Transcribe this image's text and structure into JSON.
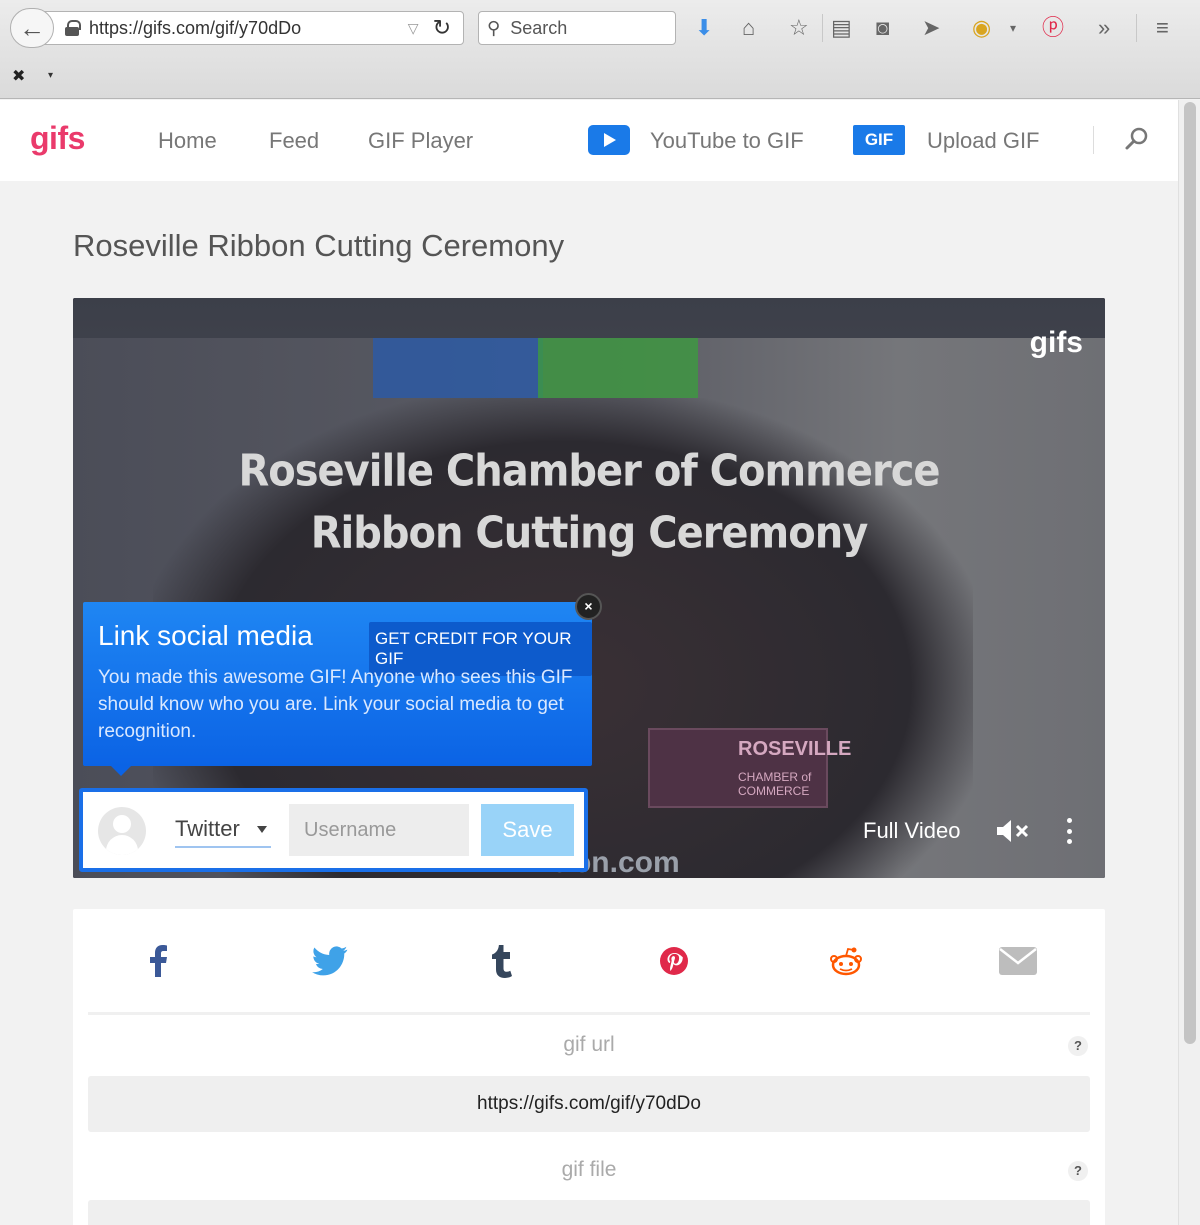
{
  "browser": {
    "url": "https://gifs.com/gif/y70dDo",
    "search_placeholder": "Search"
  },
  "site": {
    "logo": "gifs",
    "nav": {
      "home": "Home",
      "feed": "Feed",
      "gif_player": "GIF Player",
      "youtube_to_gif": "YouTube to GIF",
      "gif_badge": "GIF",
      "upload_gif": "Upload GIF"
    },
    "accent_color": "#ea3a6b",
    "brand_blue": "#1a7ae8"
  },
  "page": {
    "title": "Roseville Ribbon Cutting Ceremony"
  },
  "player": {
    "overlay_line1": "Roseville Chamber of Commerce",
    "overlay_line2": "Ribbon Cutting Ceremony",
    "watermark": "gifs",
    "plate_title": "ROSEVILLE",
    "plate_sub1": "CHAMBER of",
    "plate_sub2": "COMMERCE",
    "bottom_url": "t-on.com",
    "full_video_label": "Full Video"
  },
  "popup": {
    "heading": "Link social media",
    "credit_button": "GET CREDIT FOR YOUR GIF",
    "body": "You made this awesome GIF! Anyone who sees this GIF should know who you are. Link your social media to get recognition.",
    "close_label": "×"
  },
  "social_form": {
    "platform": "Twitter",
    "username_placeholder": "Username",
    "save_label": "Save"
  },
  "share": {
    "icons": [
      "facebook-icon",
      "twitter-icon",
      "tumblr-icon",
      "pinterest-icon",
      "reddit-icon",
      "email-icon"
    ],
    "gif_url_label": "gif url",
    "gif_url_value": "https://gifs.com/gif/y70dDo",
    "gif_file_label": "gif file",
    "help_label": "?"
  }
}
